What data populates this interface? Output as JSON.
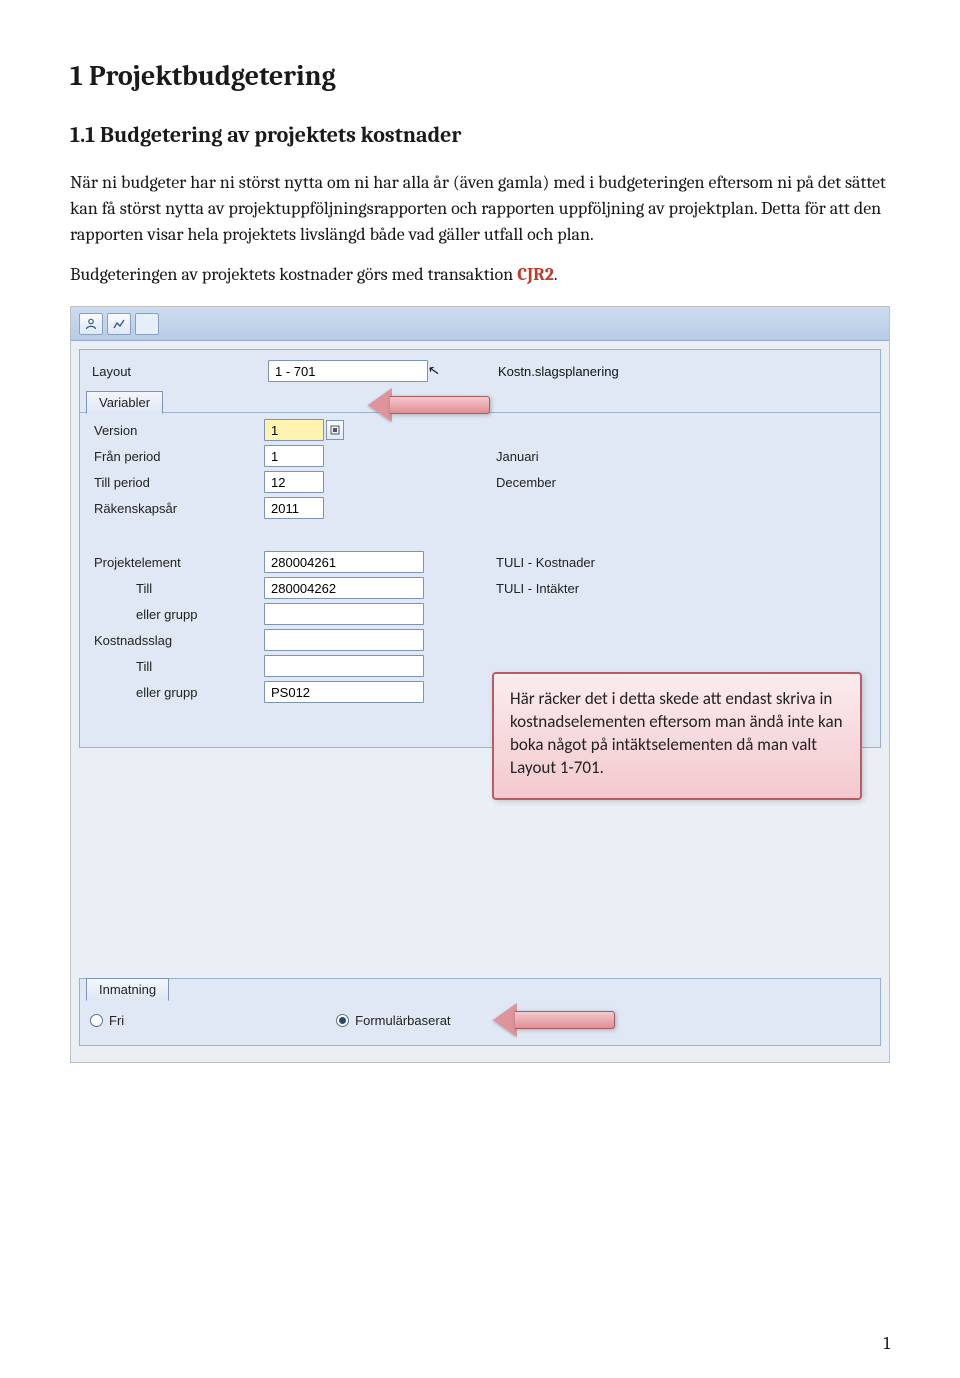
{
  "doc": {
    "h1": "1 Projektbudgetering",
    "h2": "1.1 Budgetering av projektets kostnader",
    "para1": "När ni budgeter har ni störst nytta om ni har alla år (även gamla) med i budgeteringen eftersom ni på det sättet kan få störst nytta av projektuppföljningsrapporten och rapporten uppföljning av projektplan. Detta för att den rapporten visar hela projektets livslängd både vad gäller utfall och plan.",
    "para2_pre": "Budgeteringen av projektets kostnader görs med transaktion ",
    "txn": "CJR2",
    "para2_post": ".",
    "page_num": "1"
  },
  "sap": {
    "layout_label": "Layout",
    "layout_value": "1 - 701",
    "layout_desc": "Kostn.slagsplanering",
    "tab_variabler": "Variabler",
    "rows": {
      "version": {
        "label": "Version",
        "value": "1"
      },
      "from_period": {
        "label": "Från period",
        "value": "1",
        "desc": "Januari"
      },
      "to_period": {
        "label": "Till period",
        "value": "12",
        "desc": "December"
      },
      "fy": {
        "label": "Räkenskapsår",
        "value": "2011"
      },
      "proj_elem": {
        "label": "Projektelement",
        "value": "280004261",
        "desc": "TULI - Kostnader"
      },
      "proj_till": {
        "label": "Till",
        "value": "280004262",
        "desc": "TULI - Intäkter"
      },
      "proj_grupp": {
        "label": "eller grupp",
        "value": ""
      },
      "kostslag": {
        "label": "Kostnadsslag",
        "value": ""
      },
      "kost_till": {
        "label": "Till",
        "value": ""
      },
      "kost_grupp": {
        "label": "eller grupp",
        "value": "PS012"
      }
    },
    "callout": "Här räcker det i detta skede att endast skriva in kostnadselementen eftersom man ändå inte kan boka något på intäktselementen då man valt Layout 1-701.",
    "input_tab": "Inmatning",
    "radio_free": "Fri",
    "radio_form": "Formulärbaserat"
  }
}
